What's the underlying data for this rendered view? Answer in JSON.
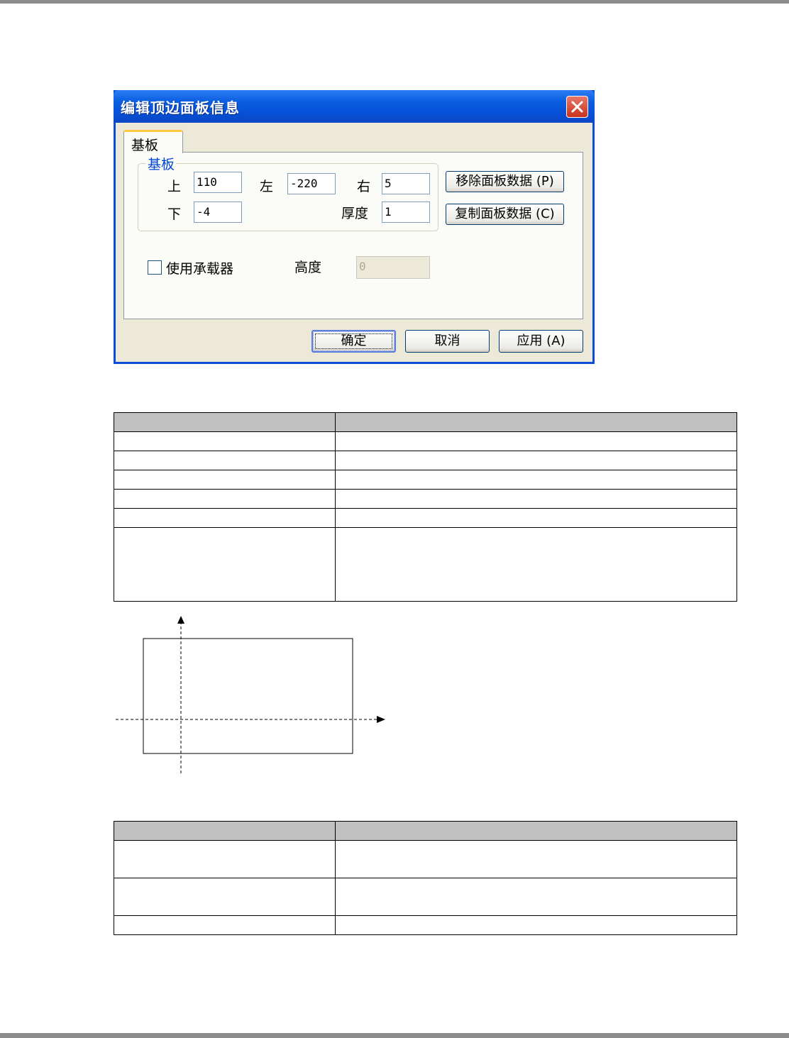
{
  "dialog": {
    "title": "编辑顶边面板信息",
    "tab_label": "基板",
    "group_label": "基板",
    "fields": {
      "top": {
        "label": "上",
        "value": "110"
      },
      "left": {
        "label": "左",
        "value": "-220"
      },
      "right": {
        "label": "右",
        "value": "5"
      },
      "bottom": {
        "label": "下",
        "value": "-4"
      },
      "thickness": {
        "label": "厚度",
        "value": "1"
      }
    },
    "remove_button": "移除面板数据 (P)",
    "copy_button": "复制面板数据 (C)",
    "use_carrier_label": "使用承载器",
    "use_carrier_checked": false,
    "height_label": "高度",
    "height_value": "0",
    "ok_button": "确定",
    "cancel_button": "取消",
    "apply_button": "应用 (A)",
    "colors": {
      "titlebar": "#0a5ee0",
      "client_bg": "#ece9d8",
      "group_label": "#0046d5",
      "tab_highlight": "#ffc83c",
      "close_button": "#d0452f"
    }
  },
  "icons": {
    "close": "close-icon",
    "axis_arrow": "arrow-icon"
  }
}
